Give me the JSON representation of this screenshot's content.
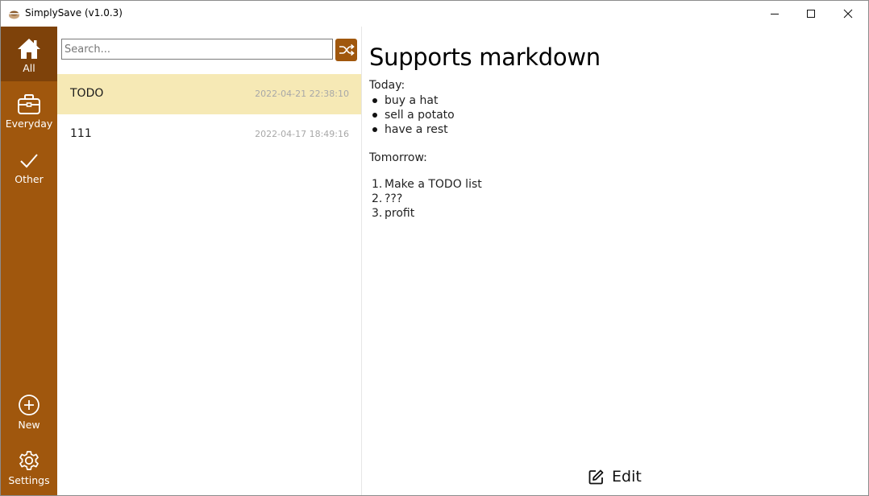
{
  "window": {
    "title": "SimplySave (v1.0.3)"
  },
  "sidebar": {
    "items": [
      {
        "label": "All",
        "icon": "home-icon",
        "active": true
      },
      {
        "label": "Everyday",
        "icon": "briefcase-icon",
        "active": false
      },
      {
        "label": "Other",
        "icon": "checkmark-icon",
        "active": false
      }
    ],
    "bottom_items": [
      {
        "label": "New",
        "icon": "plus-circle-icon"
      },
      {
        "label": "Settings",
        "icon": "gear-icon"
      }
    ]
  },
  "search": {
    "placeholder": "Search...",
    "value": ""
  },
  "notes": [
    {
      "title": "TODO",
      "date": "2022-04-21 22:38:10",
      "selected": true
    },
    {
      "title": "111",
      "date": "2022-04-17 18:49:16",
      "selected": false
    }
  ],
  "document": {
    "title": "Supports markdown",
    "section1_heading": "Today:",
    "section1_items": [
      "buy a hat",
      "sell a potato",
      "have a rest"
    ],
    "section2_heading": "Tomorrow:",
    "section2_items": [
      "Make a TODO list",
      "???",
      "profit"
    ],
    "section2_numbers": [
      "1.",
      "2.",
      "3."
    ]
  },
  "edit_button": {
    "label": "Edit",
    "icon": "edit-icon"
  },
  "colors": {
    "sidebar_bg": "#a0570d",
    "sidebar_active_bg": "#7e420a",
    "selected_note_bg": "#f6e9b5",
    "accent": "#a0570d"
  }
}
